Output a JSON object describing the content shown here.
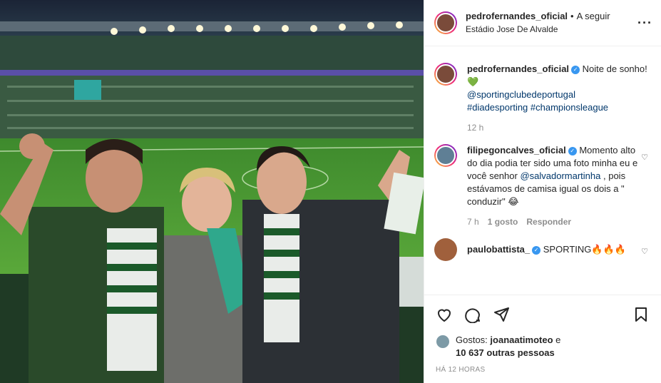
{
  "post": {
    "author": "pedrofernandes_oficial",
    "dot": "•",
    "follow_label": "A seguir",
    "location": "Estádio Jose De Alvalde",
    "more_icon": "more-icon"
  },
  "caption": {
    "author": "pedrofernandes_oficial",
    "text": "Noite de sonho!",
    "emoji": "💚",
    "mention": "@sportingclubedeportugal",
    "hashtags": "#diadesporting #championsleague",
    "time": "12 h"
  },
  "comments": [
    {
      "author": "filipegoncalves_oficial",
      "text_a": "Momento alto do dia podia ter sido uma foto minha eu e você senhor",
      "mention": "@salvadormartinha",
      "text_b": ", pois estávamos de camisa igual os dois a \" conduzir\"",
      "emoji": "😂",
      "time": "7 h",
      "likes": "1 gosto",
      "reply": "Responder"
    },
    {
      "author": "paulobattista_",
      "text": "SPORTING🔥🔥🔥"
    }
  ],
  "likes": {
    "prefix": "Gostos:",
    "user": "joanaatimoteo",
    "conj": "e",
    "others": "10 637 outras pessoas"
  },
  "timestamp": "HÁ 12 HORAS",
  "colors": {
    "verified": "#3897f0",
    "link": "#00376b",
    "heart": "#3db83d"
  }
}
